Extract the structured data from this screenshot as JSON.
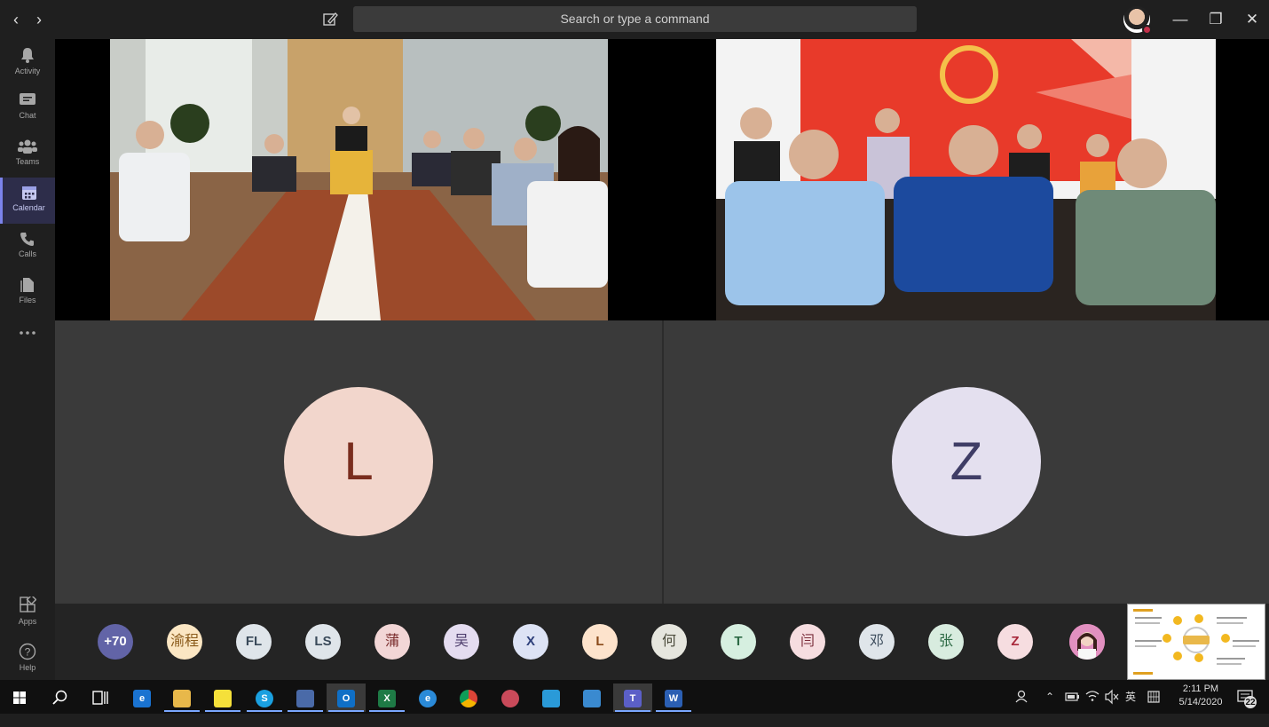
{
  "topbar": {
    "search_placeholder": "Search or type a command"
  },
  "rail": {
    "items": [
      {
        "label": "Activity",
        "icon": "bell-icon"
      },
      {
        "label": "Chat",
        "icon": "chat-icon"
      },
      {
        "label": "Teams",
        "icon": "teams-icon"
      },
      {
        "label": "Calendar",
        "icon": "calendar-icon"
      },
      {
        "label": "Calls",
        "icon": "phone-icon"
      },
      {
        "label": "Files",
        "icon": "file-icon"
      },
      {
        "label": "…",
        "icon": "more-icon"
      }
    ],
    "bottom": [
      {
        "label": "Apps",
        "icon": "apps-icon"
      },
      {
        "label": "Help",
        "icon": "help-icon"
      }
    ],
    "active": "Calendar"
  },
  "stage": {
    "tiles": [
      {
        "initial": "L",
        "bg": "#f2d6cc",
        "fg": "#7a2d1e"
      },
      {
        "initial": "Z",
        "bg": "#e4e0ef",
        "fg": "#3f3d66"
      }
    ]
  },
  "participants": [
    {
      "label": "+70",
      "bg": "#6264a7",
      "fg": "#ffffff"
    },
    {
      "label": "渝程",
      "bg": "#fbe6c3",
      "fg": "#8a5a1a"
    },
    {
      "label": "FL",
      "bg": "#dfe5ea",
      "fg": "#3a4a5a"
    },
    {
      "label": "LS",
      "bg": "#dfe5ea",
      "fg": "#3a4a5a"
    },
    {
      "label": "蒲",
      "bg": "#f2d6d6",
      "fg": "#7a2d2d"
    },
    {
      "label": "吴",
      "bg": "#e4dcf0",
      "fg": "#4a3a6a"
    },
    {
      "label": "X",
      "bg": "#dde3f5",
      "fg": "#2d3f7a"
    },
    {
      "label": "L",
      "bg": "#fde3cc",
      "fg": "#8a4a1a"
    },
    {
      "label": "何",
      "bg": "#e6e6de",
      "fg": "#4a4a3a"
    },
    {
      "label": "T",
      "bg": "#d6efe0",
      "fg": "#2d6a45"
    },
    {
      "label": "闫",
      "bg": "#f6dde0",
      "fg": "#7a2d3a"
    },
    {
      "label": "邓",
      "bg": "#dfe5ea",
      "fg": "#3a4a5a"
    },
    {
      "label": "张",
      "bg": "#d8ecdf",
      "fg": "#2d6a45"
    },
    {
      "label": "Z",
      "bg": "#f6dde0",
      "fg": "#a8283a"
    }
  ],
  "taskbar": {
    "apps": [
      "start-icon",
      "search-icon",
      "task-view-icon",
      "edge-icon",
      "file-explorer-icon",
      "sticky-notes-icon",
      "skype-icon",
      "remote-desktop-icon",
      "outlook-icon",
      "excel-icon",
      "ie-icon",
      "chrome-icon",
      "snip-icon",
      "app-icon",
      "mail-icon",
      "teams-icon",
      "word-icon"
    ],
    "tray_ime": "英",
    "time": "2:11 PM",
    "date": "5/14/2020",
    "notifications": "22"
  }
}
